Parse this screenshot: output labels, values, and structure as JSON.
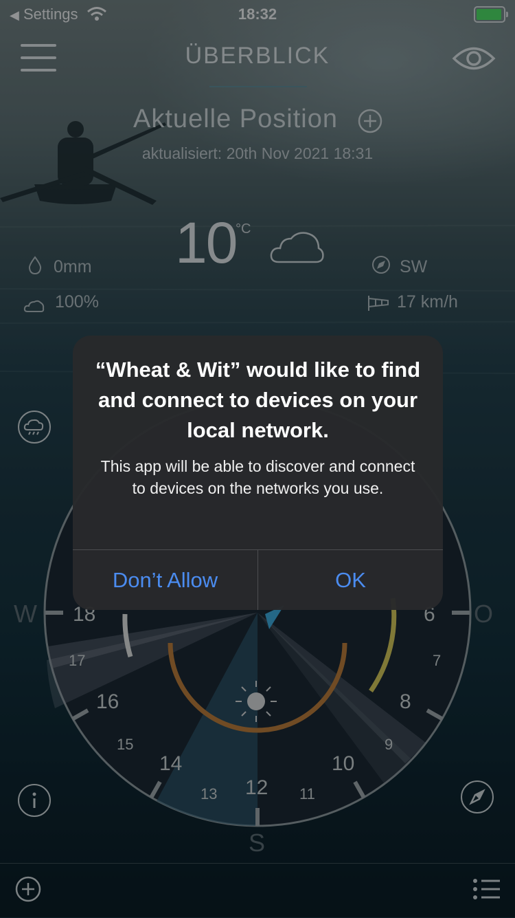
{
  "status_bar": {
    "back_label": "Settings",
    "time": "18:32"
  },
  "header": {
    "title": "ÜBERBLICK"
  },
  "location": {
    "title": "Aktuelle Position",
    "updated": "aktualisiert: 20th Nov 2021 18:31"
  },
  "weather": {
    "temperature": "10",
    "temperature_unit": "°C",
    "precipitation": "0mm",
    "cloud_cover": "100%",
    "wind_direction": "SW",
    "wind_speed": "17 km/h"
  },
  "dial": {
    "hours": [
      "18",
      "17",
      "16",
      "15",
      "14",
      "13",
      "12",
      "11",
      "10",
      "9",
      "8",
      "7",
      "6"
    ],
    "compass": {
      "west": "W",
      "south": "S",
      "east": "O"
    }
  },
  "alert": {
    "title": "“Wheat & Wit” would like to find and connect to devices on your local network.",
    "message": "This app will be able to discover and connect to devices on the networks you use.",
    "deny_label": "Don’t Allow",
    "ok_label": "OK"
  },
  "colors": {
    "alert_bg": "#28292b",
    "alert_button": "#4b8cf0",
    "accent_line": "#5c8a96"
  },
  "icons": [
    "wifi-icon",
    "battery-icon",
    "menu-icon",
    "eye-icon",
    "add-location-icon",
    "cloud-icon",
    "raindrop-icon",
    "compass-icon",
    "windsock-icon",
    "rain-cloud-icon",
    "info-icon",
    "navigation-icon",
    "add-icon",
    "list-icon",
    "sun-icon"
  ]
}
